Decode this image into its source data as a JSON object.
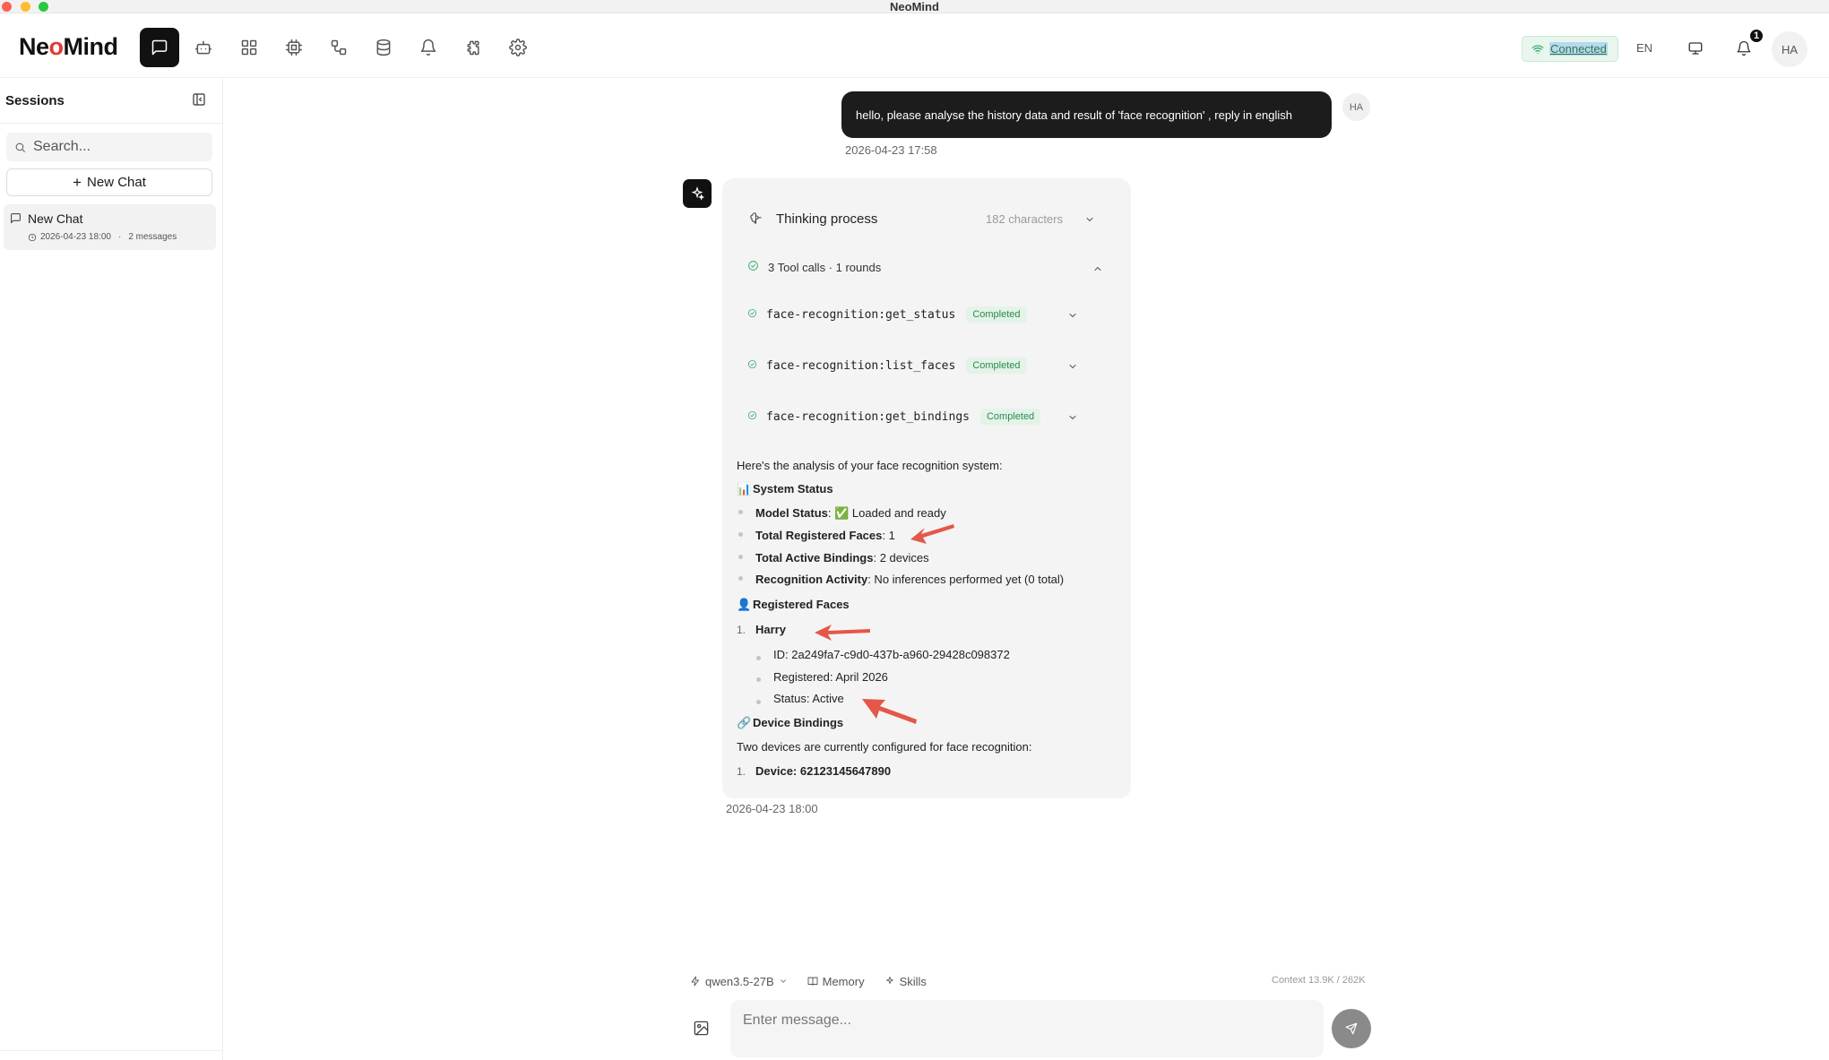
{
  "window": {
    "title": "NeoMind"
  },
  "app": {
    "logo_pre": "Ne",
    "logo_o": "o",
    "logo_post": "Mind"
  },
  "nav": {
    "items": [
      {
        "name": "chat",
        "icon": "message-square-icon",
        "active": true
      },
      {
        "name": "agents",
        "icon": "bot-icon",
        "active": false
      },
      {
        "name": "dashboards",
        "icon": "layout-grid-icon",
        "active": false
      },
      {
        "name": "devices",
        "icon": "cpu-icon",
        "active": false
      },
      {
        "name": "automation",
        "icon": "workflow-icon",
        "active": false
      },
      {
        "name": "data",
        "icon": "database-icon",
        "active": false
      },
      {
        "name": "alerts",
        "icon": "bell-icon",
        "active": false
      },
      {
        "name": "extensions",
        "icon": "puzzle-icon",
        "active": false
      },
      {
        "name": "settings",
        "icon": "gear-icon",
        "active": false
      }
    ]
  },
  "header": {
    "connection_status": "Connected",
    "language": "EN",
    "notification_count": "1",
    "user_initials": "HA"
  },
  "sidebar": {
    "title": "Sessions",
    "search_placeholder": "Search...",
    "new_chat_label": "New Chat",
    "sessions": [
      {
        "title": "New Chat",
        "date": "2026-04-23 18:00",
        "sep": "·",
        "messages": "2 messages"
      }
    ]
  },
  "chat": {
    "user_message": {
      "text": "hello, please analyse the history data and result of 'face recognition' , reply in english",
      "avatar": "HA",
      "time": "2026-04-23 17:58"
    },
    "assistant": {
      "thinking_label": "Thinking process",
      "thinking_chars": "182 characters",
      "tool_summary": "3 Tool calls · 1 rounds",
      "tool_calls": [
        {
          "name": "face-recognition:get_status",
          "status": "Completed"
        },
        {
          "name": "face-recognition:list_faces",
          "status": "Completed"
        },
        {
          "name": "face-recognition:get_bindings",
          "status": "Completed"
        }
      ],
      "intro": "Here's the analysis of your face recognition system:",
      "system_status": {
        "emoji": "📊",
        "heading": "System Status",
        "items": [
          {
            "label": "Model Status",
            "value": ": ✅ Loaded and ready"
          },
          {
            "label": "Total Registered Faces",
            "value": ": 1"
          },
          {
            "label": "Total Active Bindings",
            "value": ": 2 devices"
          },
          {
            "label": "Recognition Activity",
            "value": ": No inferences performed yet (0 total)"
          }
        ]
      },
      "registered_faces": {
        "emoji": "👤",
        "heading": "Registered Faces",
        "num": "1.",
        "name": "Harry",
        "details": [
          "ID: 2a249fa7-c9d0-437b-a960-29428c098372",
          "Registered: April 2026",
          "Status: Active"
        ]
      },
      "device_bindings": {
        "emoji": "🔗",
        "heading": "Device Bindings",
        "text": "Two devices are currently configured for face recognition:",
        "num": "1.",
        "device_label": "Device: 62123145647890"
      },
      "time": "2026-04-23 18:00"
    }
  },
  "composer": {
    "model": "qwen3.5-27B",
    "memory_label": "Memory",
    "skills_label": "Skills",
    "context": "Context 13.9K / 262K",
    "placeholder": "Enter message..."
  },
  "colors": {
    "accent_dark": "#111111",
    "connected_green": "#2aa55a",
    "completed_badge": "#e3f3e8",
    "annotation_arrow": "#e4574a"
  }
}
